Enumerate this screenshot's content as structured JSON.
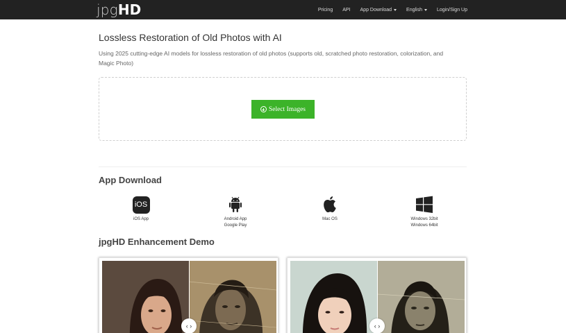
{
  "navbar": {
    "logo_light": "jpg",
    "logo_bold": "HD",
    "links": [
      {
        "label": "Pricing",
        "dropdown": false
      },
      {
        "label": "API",
        "dropdown": false
      },
      {
        "label": "App Download",
        "dropdown": true
      },
      {
        "label": "English",
        "dropdown": true
      },
      {
        "label": "Login/Sign Up",
        "dropdown": false
      }
    ]
  },
  "hero": {
    "title": "Lossless Restoration of Old Photos with AI",
    "subtitle": "Using 2025 cutting-edge AI models for lossless restoration of old photos (supports old, scratched photo restoration, colorization, and Magic Photo)",
    "select_button": "Select Images"
  },
  "app_download": {
    "title": "App Download",
    "items": [
      {
        "icon": "ios-icon",
        "badge": "iOS",
        "line1": "iOS App",
        "line2": ""
      },
      {
        "icon": "android-icon",
        "line1": "Android App",
        "line2": "Google Play"
      },
      {
        "icon": "apple-icon",
        "line1": "Mac OS",
        "line2": ""
      },
      {
        "icon": "windows-icon",
        "line1": "Windows 32bit",
        "line2": "Windows 64bit"
      }
    ]
  },
  "demo": {
    "title": "jpgHD Enhancement Demo",
    "handle": "‹ ›"
  },
  "colors": {
    "navbar_bg": "#222222",
    "accent_green": "#3cb329"
  }
}
